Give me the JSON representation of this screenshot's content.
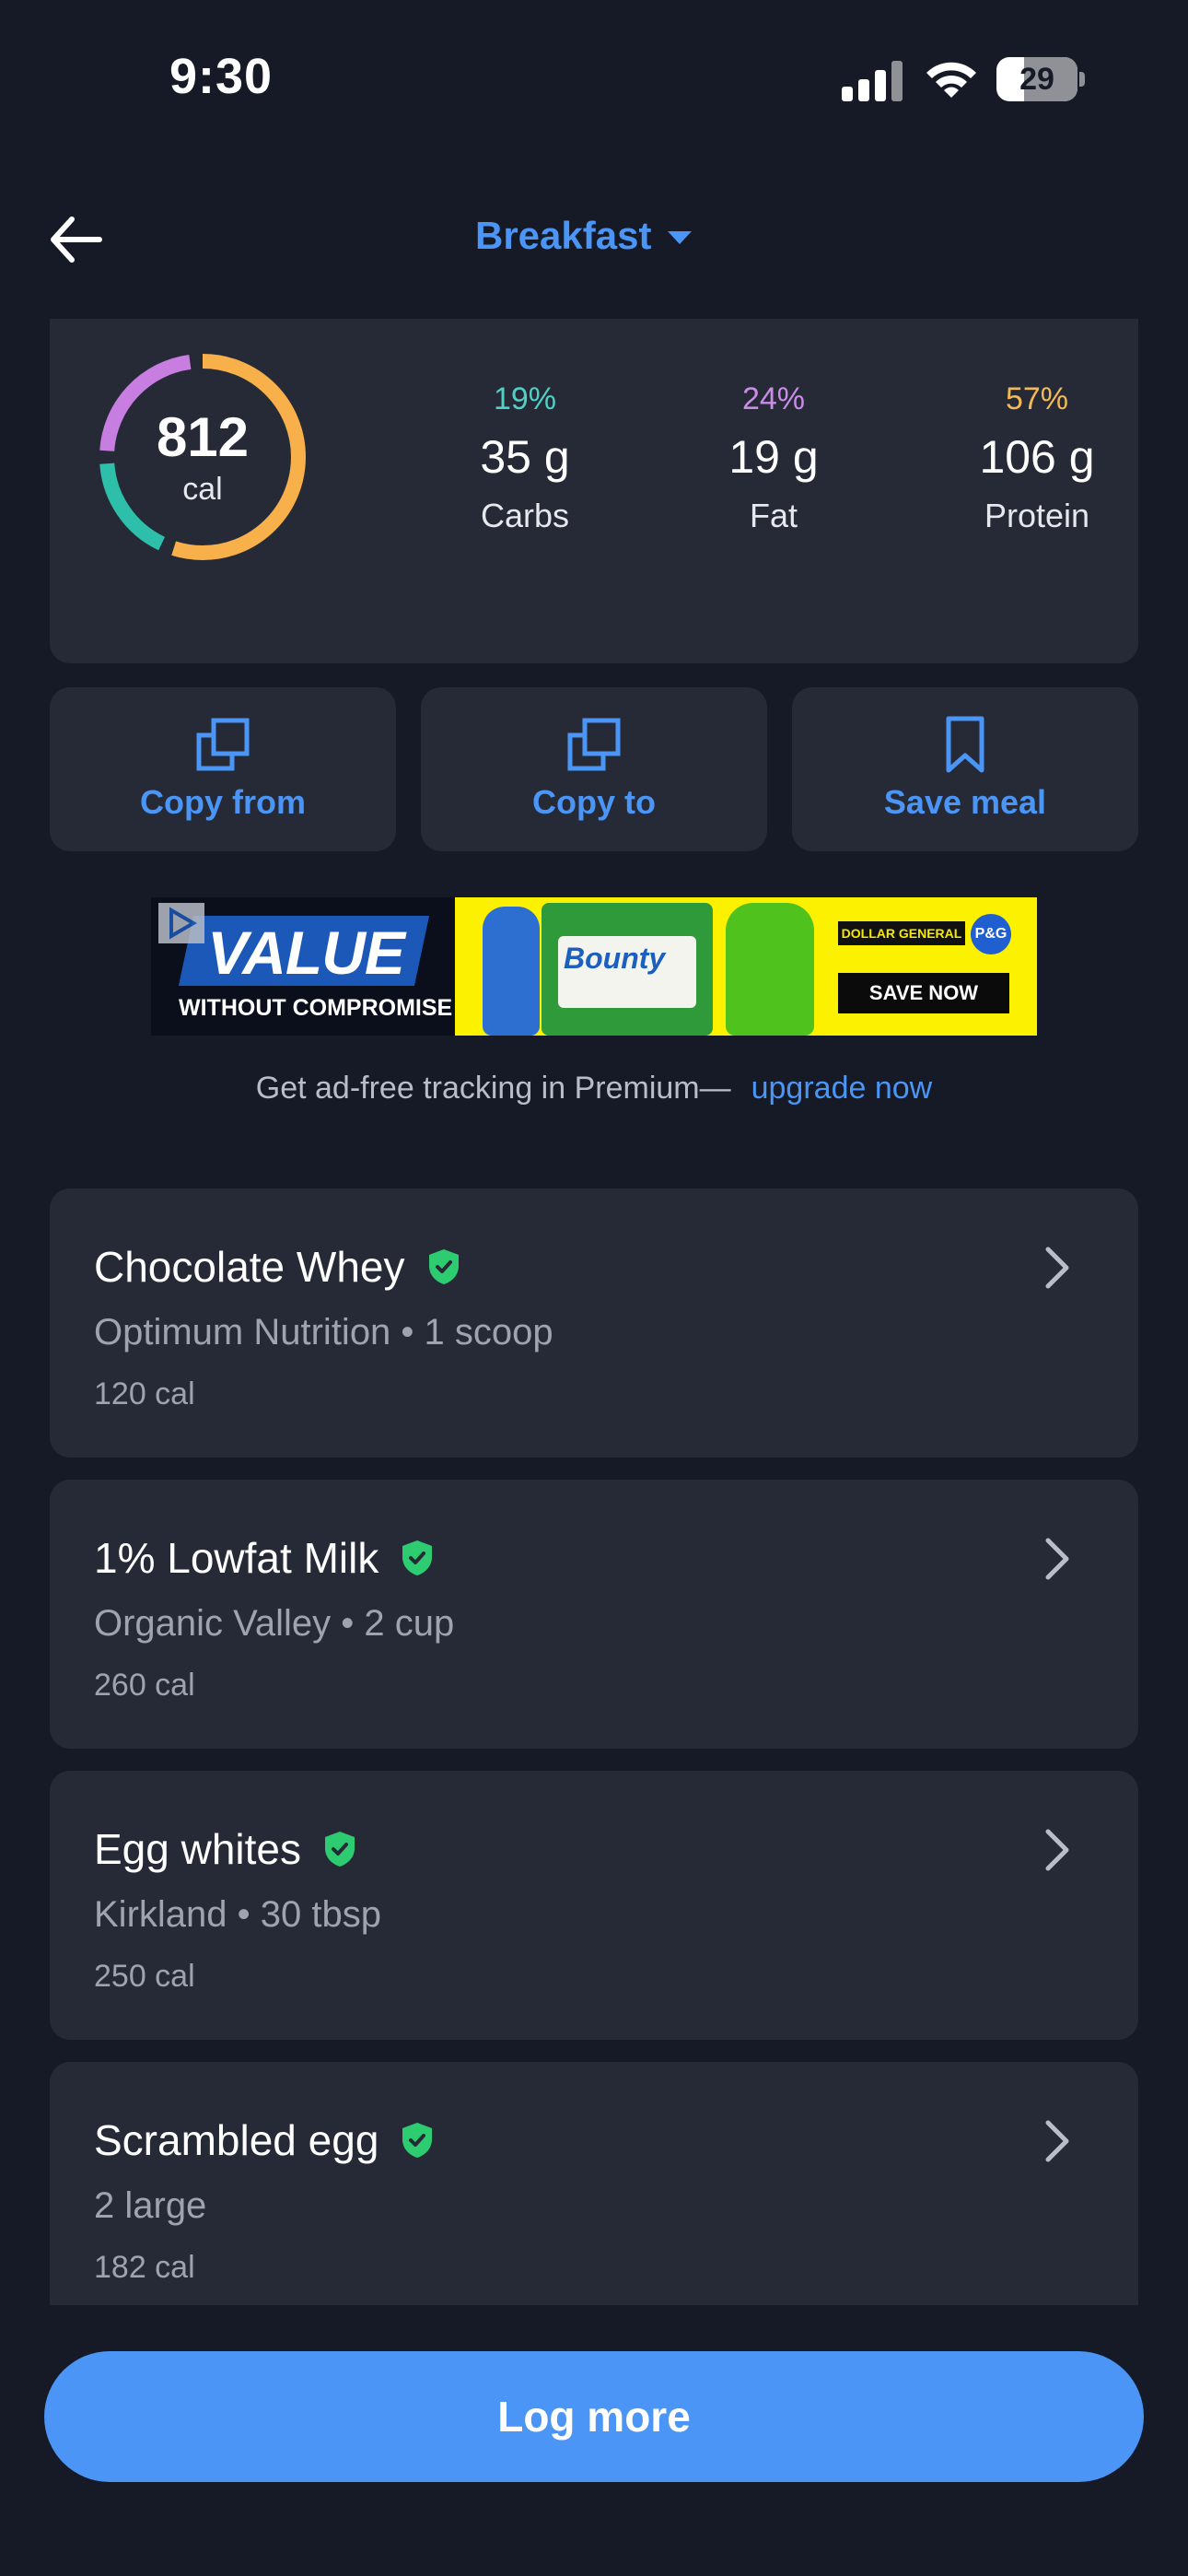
{
  "status_bar": {
    "time": "9:30",
    "battery": "29"
  },
  "header": {
    "title": "Breakfast"
  },
  "summary": {
    "calories": "812",
    "calories_unit": "cal",
    "ring_colors": {
      "carbs": "#2dbfa9",
      "fat": "#c77ee0",
      "protein": "#f7b04a"
    },
    "macros": [
      {
        "percent": "19%",
        "grams": "35 g",
        "label": "Carbs",
        "color": "#4fd1c5"
      },
      {
        "percent": "24%",
        "grams": "19 g",
        "label": "Fat",
        "color": "#c98de8"
      },
      {
        "percent": "57%",
        "grams": "106 g",
        "label": "Protein",
        "color": "#f2b95a"
      }
    ]
  },
  "actions": [
    {
      "label": "Copy from",
      "icon": "copy-icon"
    },
    {
      "label": "Copy to",
      "icon": "copy-icon"
    },
    {
      "label": "Save meal",
      "icon": "bookmark-icon"
    }
  ],
  "ad": {
    "headline": "VALUE",
    "tagline": "WITHOUT COMPROMISE",
    "brand_text": "Bounty",
    "retailer": "DOLLAR GENERAL",
    "pg": "P&G",
    "cta": "SAVE NOW"
  },
  "premium": {
    "text": "Get ad-free tracking in Premium—",
    "link": "upgrade now"
  },
  "foods": [
    {
      "name": "Chocolate Whey",
      "detail": "Optimum Nutrition • 1 scoop",
      "calories": "120 cal",
      "verified": true
    },
    {
      "name": "1% Lowfat Milk",
      "detail": "Organic Valley • 2 cup",
      "calories": "260 cal",
      "verified": true
    },
    {
      "name": "Egg whites",
      "detail": "Kirkland • 30 tbsp",
      "calories": "250 cal",
      "verified": true
    },
    {
      "name": "Scrambled egg",
      "detail": "2 large",
      "calories": "182 cal",
      "verified": true
    }
  ],
  "log_more": {
    "label": "Log more"
  },
  "colors": {
    "background": "#151a26",
    "card": "#262a37",
    "accent": "#4a95f5",
    "verified": "#2ecc71"
  }
}
